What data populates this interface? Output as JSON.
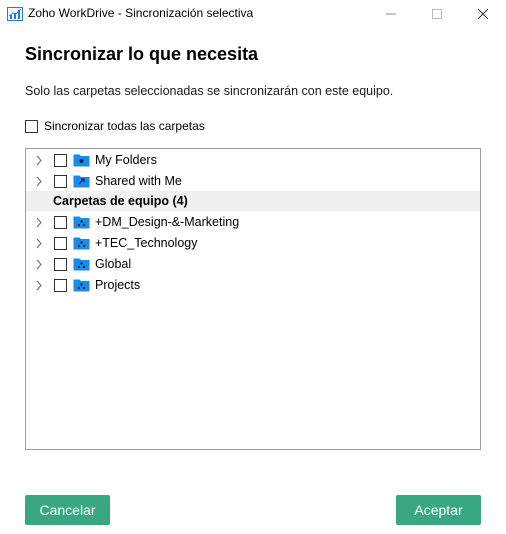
{
  "window": {
    "title": "Zoho WorkDrive - Sincronización selectiva",
    "icon": "workdrive-chart-icon",
    "controls": [
      "minimize-icon",
      "maximize-icon",
      "close-icon"
    ]
  },
  "dialog": {
    "heading": "Sincronizar lo que necesita",
    "description": "Solo las carpetas seleccionadas se sincronizarán con este equipo.",
    "sync_all_label": "Sincronizar todas las carpetas",
    "sync_all_checked": false
  },
  "tree": {
    "personal_items": [
      {
        "label": "My Folders",
        "icon": "my-folders-icon",
        "checked": false
      },
      {
        "label": "Shared with Me",
        "icon": "shared-folder-icon",
        "checked": false
      }
    ],
    "team_section_label": "Carpetas de equipo (4)",
    "team_items": [
      {
        "label": "+DM_Design-&-Marketing",
        "icon": "team-folder-icon",
        "checked": false
      },
      {
        "label": "+TEC_Technology",
        "icon": "team-folder-icon",
        "checked": false
      },
      {
        "label": "Global",
        "icon": "team-folder-icon",
        "checked": false
      },
      {
        "label": "Projects",
        "icon": "team-folder-icon",
        "checked": false
      }
    ]
  },
  "buttons": {
    "cancel_label": "Cancelar",
    "accept_label": "Aceptar"
  },
  "colors": {
    "accent": "#3aa783",
    "folder": "#1a8ce8",
    "section_bg": "#f0f0f0"
  }
}
